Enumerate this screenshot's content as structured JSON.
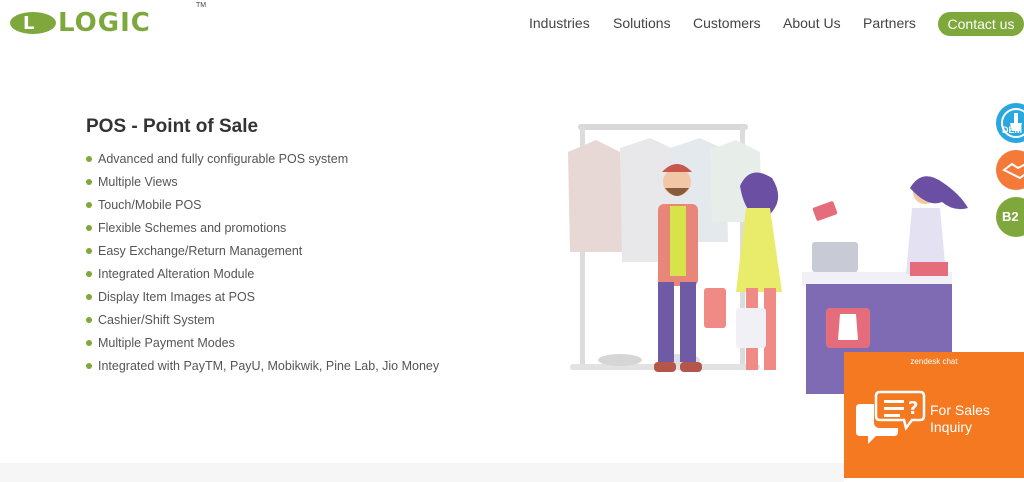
{
  "brand": {
    "logo_letter": "L",
    "logo_text": "LOGIC",
    "trademark": "TM"
  },
  "nav": {
    "items": [
      "Industries",
      "Solutions",
      "Customers",
      "About Us",
      "Partners"
    ],
    "contact_label": "Contact us"
  },
  "main": {
    "title": "POS - Point of Sale",
    "features": [
      "Advanced and fully configurable POS system",
      "Multiple Views",
      "Touch/Mobile POS",
      "Flexible Schemes and promotions",
      "Easy Exchange/Return Management",
      "Integrated Alteration Module",
      "Display Item Images at POS",
      "Cashier/Shift System",
      "Multiple Payment Modes",
      "Integrated with PayTM, PayU, Mobikwik, Pine Lab, Jio Money"
    ]
  },
  "side_badges": {
    "demo": "DEM",
    "b2b": "B2"
  },
  "chat": {
    "brand": "zendesk chat",
    "line1": "For Sales",
    "line2": "Inquiry"
  },
  "colors": {
    "brand_green": "#7ea83c",
    "chat_orange": "#f47920",
    "demo_blue": "#29a7df"
  },
  "icons": [
    "hand-pointer-icon",
    "handshake-icon",
    "chat-bubble-icon"
  ]
}
